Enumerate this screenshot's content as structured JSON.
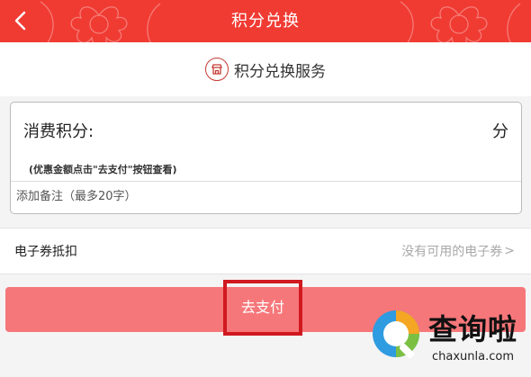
{
  "header": {
    "title": "积分兑换",
    "back_icon": "chevron-left-icon",
    "color": "#f03b33"
  },
  "service": {
    "title": "积分兑换服务",
    "icon": "shop-icon"
  },
  "form": {
    "points_label": "消费积分:",
    "points_unit": "分",
    "discount_hint": "(优惠金额点击\"去支付\"按钮查看)",
    "remark_placeholder": "添加备注（最多20字）"
  },
  "voucher": {
    "label": "电子券抵扣",
    "status": "没有可用的电子券",
    "chevron": ">"
  },
  "pay": {
    "label": "去支付",
    "button_color": "#f6777a",
    "highlight_color": "#d0191f"
  },
  "watermark": {
    "cn": "查询啦",
    "en": "chaxunla.com"
  }
}
